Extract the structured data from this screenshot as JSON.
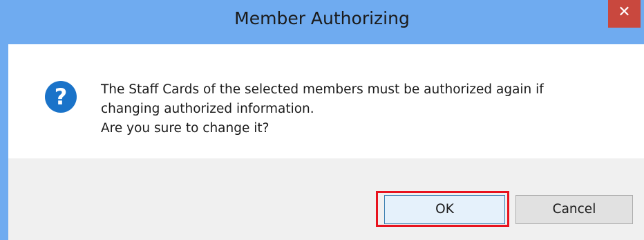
{
  "window": {
    "title": "Member Authorizing",
    "close_glyph": "✕"
  },
  "message": {
    "lines": [
      "The Staff Cards of the selected members must be authorized again if",
      "changing authorized information.",
      "Are you sure to change it?"
    ],
    "icon": "question-icon"
  },
  "buttons": {
    "ok_label": "OK",
    "cancel_label": "Cancel"
  },
  "colors": {
    "titlebar": "#6fabf0",
    "close_button": "#c9483e",
    "icon_blue": "#1a73c9",
    "highlight": "#e8131e"
  }
}
